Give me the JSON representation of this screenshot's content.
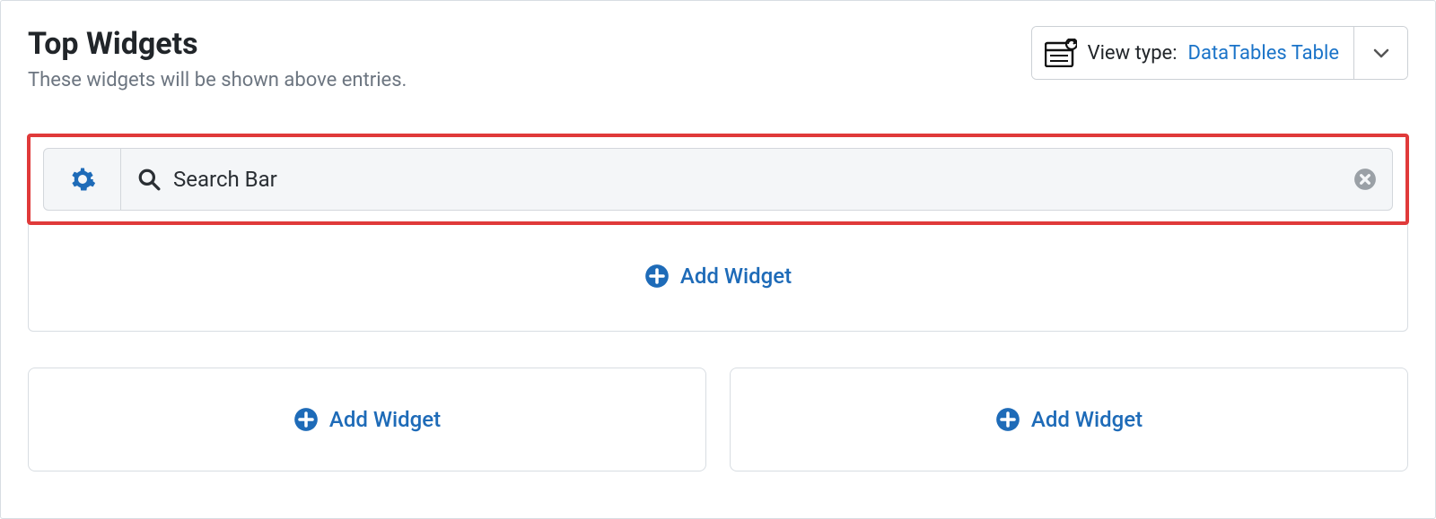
{
  "header": {
    "title": "Top Widgets",
    "subtitle": "These widgets will be shown above entries."
  },
  "viewType": {
    "label": "View type: ",
    "value": "DataTables Table"
  },
  "widgetArea": {
    "existing": {
      "name": "Search Bar"
    },
    "addLabel": "Add Widget"
  },
  "columns": {
    "left": {
      "addLabel": "Add Widget"
    },
    "right": {
      "addLabel": "Add Widget"
    }
  }
}
